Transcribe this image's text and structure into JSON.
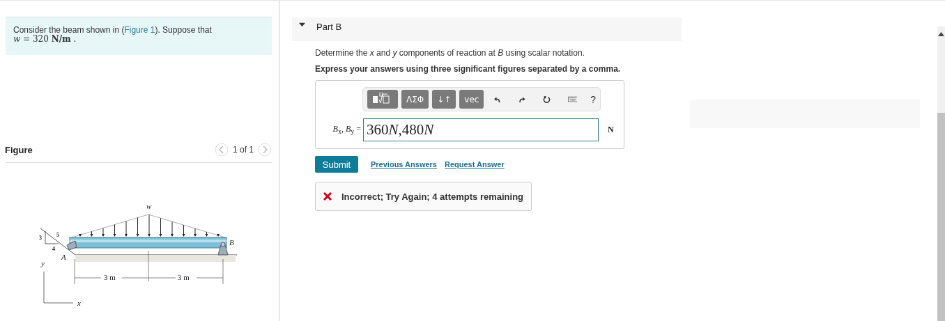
{
  "problem": {
    "before": "Consider the beam shown in (",
    "link": "Figure 1",
    "after": "). Suppose that",
    "given": "*w* = 320 **N/m** ."
  },
  "figure": {
    "title": "Figure",
    "pager": "1 of 1",
    "load_label": "w",
    "slope_rise": "3",
    "slope_run": "4",
    "slope_hyp": "5",
    "point_a": "A",
    "point_b": "B",
    "axis_y": "y",
    "axis_x": "x",
    "dims": [
      "3 m",
      "3 m"
    ]
  },
  "part": {
    "title": "Part B",
    "expanded": true,
    "question": "Determine the *x* and *y* components of reaction at *B* using scalar notation.",
    "instruction": "Express your answers using three significant figures separated by a comma.",
    "toolbar": [
      {
        "kind": "template"
      },
      {
        "kind": "text",
        "label": "ΛΣΦ"
      },
      {
        "kind": "text",
        "label": "↓↑"
      },
      {
        "kind": "text",
        "label": "vec"
      },
      {
        "kind": "undo"
      },
      {
        "kind": "redo"
      },
      {
        "kind": "reset"
      },
      {
        "kind": "keyboard"
      },
      {
        "kind": "help",
        "label": "?"
      }
    ],
    "answer_label": "*B*$_{x}$, *B*$_{y}$ =",
    "answer_value": [
      {
        "text": "360",
        "italic": false
      },
      {
        "text": "N",
        "italic": true
      },
      {
        "text": ",480",
        "italic": false
      },
      {
        "text": "N",
        "italic": true
      }
    ],
    "unit": "N",
    "submit": "Submit",
    "links": [
      "Previous Answers",
      "Request Answer"
    ],
    "feedback": {
      "kind": "error",
      "text": "Incorrect; Try Again; 4 attempts remaining"
    }
  }
}
